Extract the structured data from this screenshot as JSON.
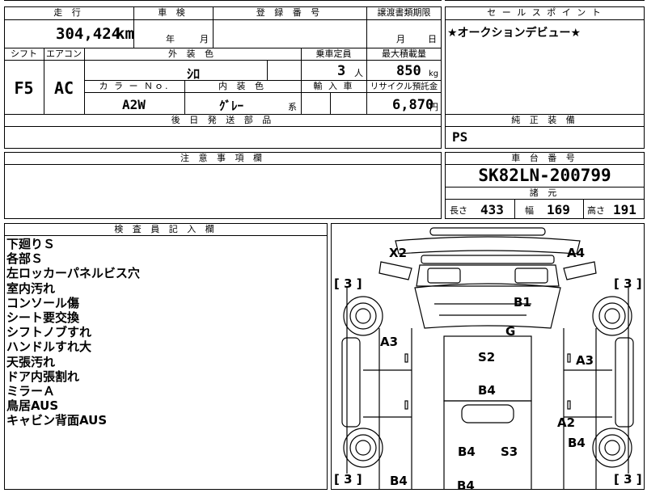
{
  "header": {
    "mileage_label": "走 行",
    "inspection_label": "車 検",
    "registration_label": "登 録 番 号",
    "transfer_label": "譲渡書類期限",
    "sales_point_label": "セ ー ル ス ポ イ ン ト",
    "mileage_value": "304,424",
    "mileage_unit": "km",
    "inspection_year": "年",
    "inspection_month": "月",
    "transfer_month": "月",
    "transfer_day": "日",
    "sales_point_text": "★オークションデビュー★"
  },
  "specs": {
    "shift_label": "シフト",
    "ac_label": "エアコン",
    "exterior_color_label": "外 装 色",
    "capacity_label": "乗車定員",
    "max_load_label": "最大積載量",
    "shift_value": "F5",
    "ac_value": "AC",
    "exterior_color_value": "ｼﾛ",
    "capacity_value": "3",
    "capacity_unit": "人",
    "max_load_value": "850",
    "max_load_unit": "kg",
    "color_no_label": "カ ラ ー Ｎｏ.",
    "interior_color_label": "内 装 色",
    "import_label": "輸 入 車",
    "recycle_label": "リサイクル預託金",
    "color_no_value": "A2W",
    "interior_color_value": "ｸﾞﾚｰ",
    "interior_color_suffix": "系",
    "recycle_value": "6,870",
    "recycle_unit": "円",
    "later_parts_label": "後 日 発 送 部 品",
    "genuine_equipment_label": "純 正 装 備",
    "genuine_equipment_value": "PS"
  },
  "caution": {
    "label": "注 意 事 項 欄"
  },
  "chassis": {
    "label": "車 台 番 号",
    "value": "SK82LN-200799",
    "specs_label": "諸 元",
    "length_label": "長さ",
    "length_value": "433",
    "width_label": "幅",
    "width_value": "169",
    "height_label": "高さ",
    "height_value": "191"
  },
  "inspector": {
    "label": "検 査 員 記 入 欄",
    "notes": [
      "下廻りＳ",
      "各部Ｓ",
      "左ロッカーパネルビス穴",
      "室内汚れ",
      "コンソール傷",
      "シート要交換",
      "シフトノブすれ",
      "ハンドルすれ大",
      "天張汚れ",
      "ドア内張割れ",
      "ミラーＡ",
      "鳥居AUS",
      "キャビン背面AUS"
    ]
  },
  "diagram": {
    "tire_marks": [
      "[ 3 ]",
      "[ 3 ]",
      "[ 3 ]",
      "[ 3 ]"
    ],
    "damage_codes": [
      "X2",
      "A4",
      "B1",
      "G",
      "A3",
      "S2",
      "A3",
      "B4",
      "A2",
      "B4",
      "S3",
      "B4",
      "B4",
      "B4"
    ]
  }
}
